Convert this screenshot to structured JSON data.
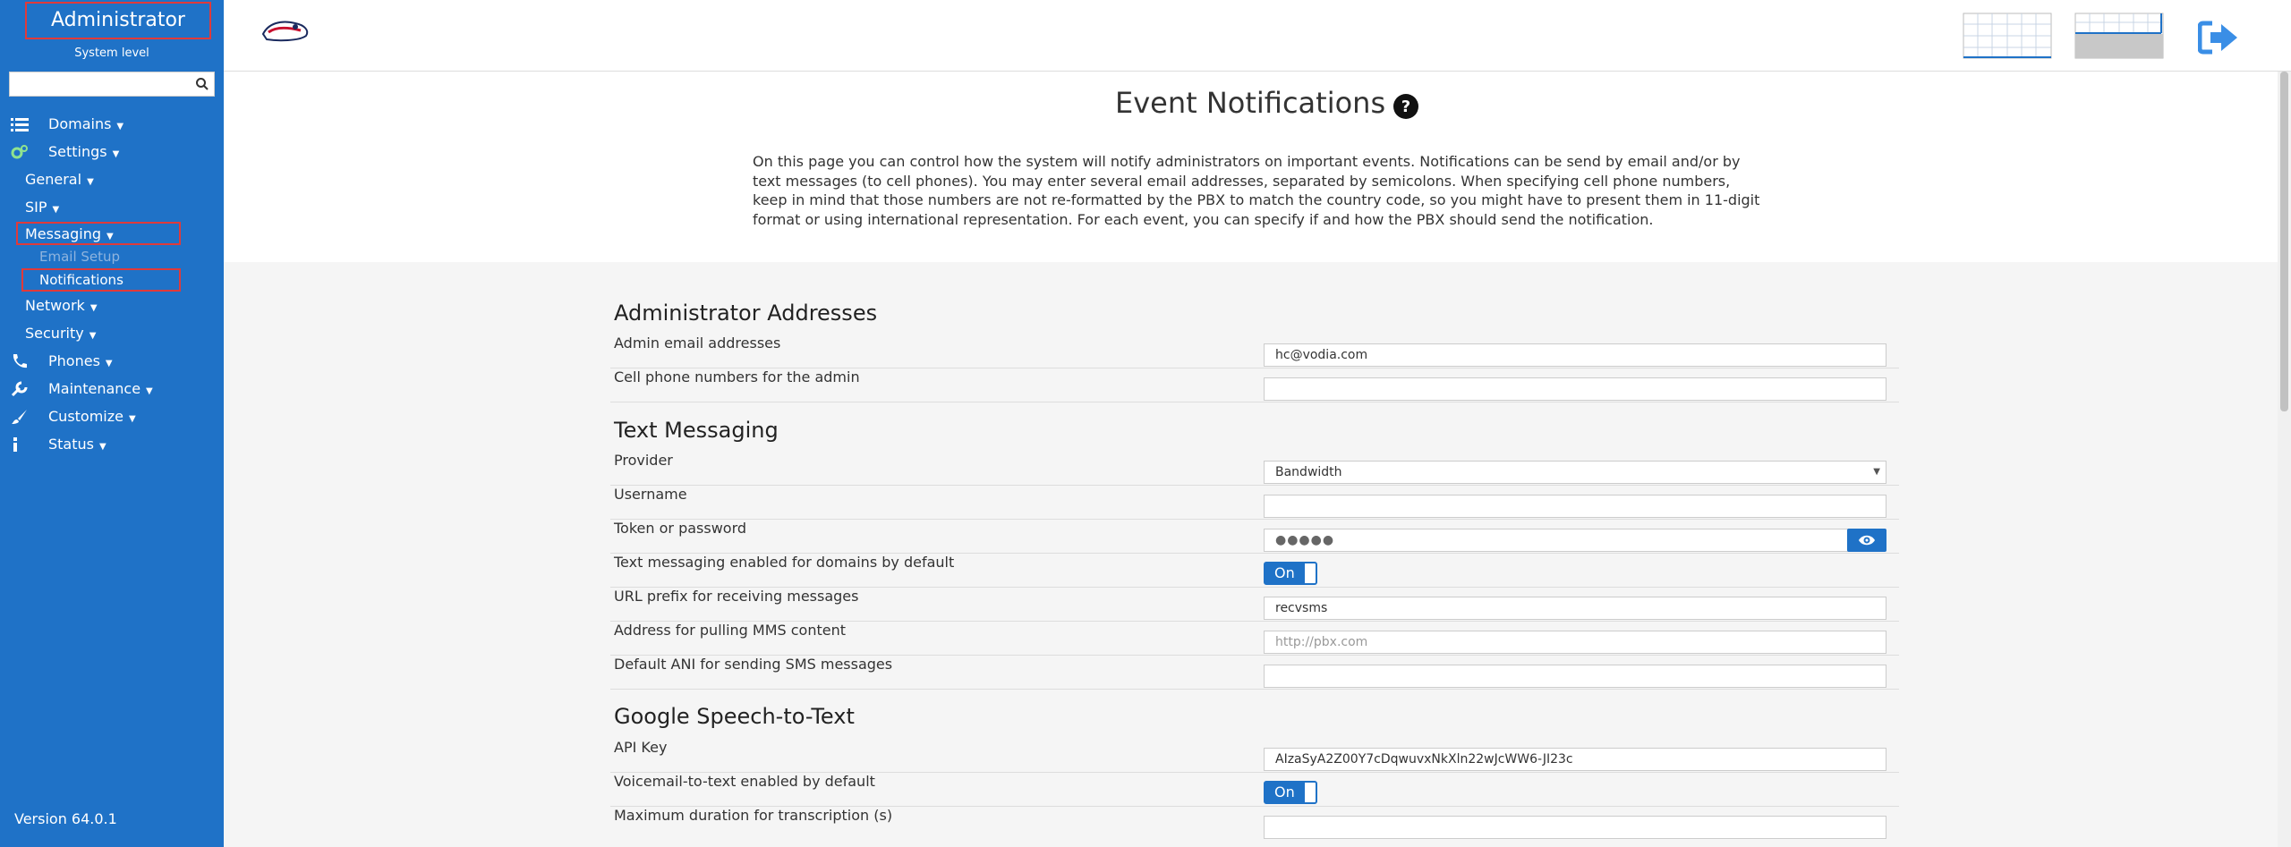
{
  "sidebar": {
    "title": "Administrator",
    "subtitle": "System level",
    "search_placeholder": "",
    "menu": {
      "domains": "Domains",
      "settings": "Settings",
      "general": "General",
      "sip": "SIP",
      "messaging": "Messaging",
      "email_setup": "Email Setup",
      "notifications": "Notifications",
      "network": "Network",
      "security": "Security",
      "phones": "Phones",
      "maintenance": "Maintenance",
      "customize": "Customize",
      "status": "Status"
    },
    "version": "Version 64.0.1"
  },
  "page": {
    "title": "Event Notifications",
    "intro": "On this page you can control how the system will notify administrators on important events. Notifications can be send by email and/or by text messages (to cell phones). You may enter several email addresses, separated by semicolons. When specifying cell phone numbers, keep in mind that those numbers are not re-formatted by the PBX to match the country code, so you might have to present them in 11-digit format or using international representation. For each event, you can specify if and how the PBX should send the notification."
  },
  "sections": {
    "admin": {
      "title": "Administrator Addresses",
      "email_label": "Admin email addresses",
      "email_value": "hc@vodia.com",
      "cell_label": "Cell phone numbers for the admin",
      "cell_value": ""
    },
    "text": {
      "title": "Text Messaging",
      "provider_label": "Provider",
      "provider_value": "Bandwidth",
      "username_label": "Username",
      "username_value": "",
      "token_label": "Token or password",
      "token_value": "●●●●●",
      "enabled_label": "Text messaging enabled for domains by default",
      "enabled_value": "On",
      "url_label": "URL prefix for receiving messages",
      "url_value": "recvsms",
      "mms_label": "Address for pulling MMS content",
      "mms_placeholder": "http://pbx.com",
      "ani_label": "Default ANI for sending SMS messages",
      "ani_value": ""
    },
    "speech": {
      "title": "Google Speech-to-Text",
      "api_label": "API Key",
      "api_value": "AIzaSyA2Z00Y7cDqwuvxNkXln22wJcWW6-JI23c",
      "vm_label": "Voicemail-to-text enabled by default",
      "vm_value": "On",
      "max_label": "Maximum duration for transcription (s)",
      "max_value": ""
    }
  },
  "colors": {
    "sidebar": "#1f72c7",
    "highlight": "#e03a3a",
    "accent": "#1f72c7"
  }
}
